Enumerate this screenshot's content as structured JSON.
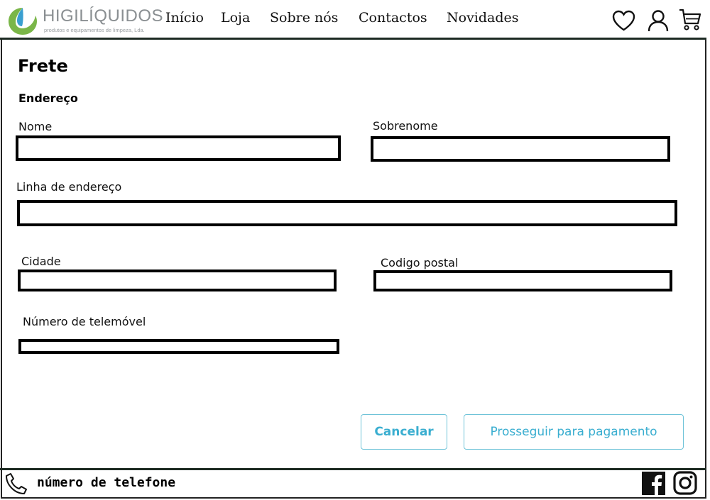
{
  "header": {
    "brand_name": "HIGILÍQUIDOS",
    "brand_tagline": "produtos e equipamentos de limpeza, Lda.",
    "nav": {
      "inicio": "Início",
      "loja": "Loja",
      "sobre": "Sobre nós",
      "contactos": "Contactos",
      "novidades": "Novidades"
    },
    "icons": [
      "heart-icon",
      "user-icon",
      "cart-icon"
    ]
  },
  "form": {
    "title": "Frete",
    "section": "Endereço",
    "fields": {
      "nome": {
        "label": "Nome",
        "value": "",
        "placeholder": ""
      },
      "sobrenome": {
        "label": "Sobrenome",
        "value": "",
        "placeholder": ""
      },
      "linha_endereco": {
        "label": "Linha de endereço",
        "value": "",
        "placeholder": ""
      },
      "cidade": {
        "label": "Cidade",
        "value": "",
        "placeholder": ""
      },
      "codigo_postal": {
        "label": "Codigo postal",
        "value": "",
        "placeholder": ""
      },
      "telemovel": {
        "label": "Número de telemóvel",
        "value": "",
        "placeholder": ""
      }
    },
    "buttons": {
      "cancel": "Cancelar",
      "proceed": "Prosseguir para pagamento"
    },
    "accent_color": "#3aaed0"
  },
  "footer": {
    "phone_text": "número de telefone",
    "icons": [
      "phone-icon",
      "facebook-icon",
      "instagram-icon"
    ]
  }
}
